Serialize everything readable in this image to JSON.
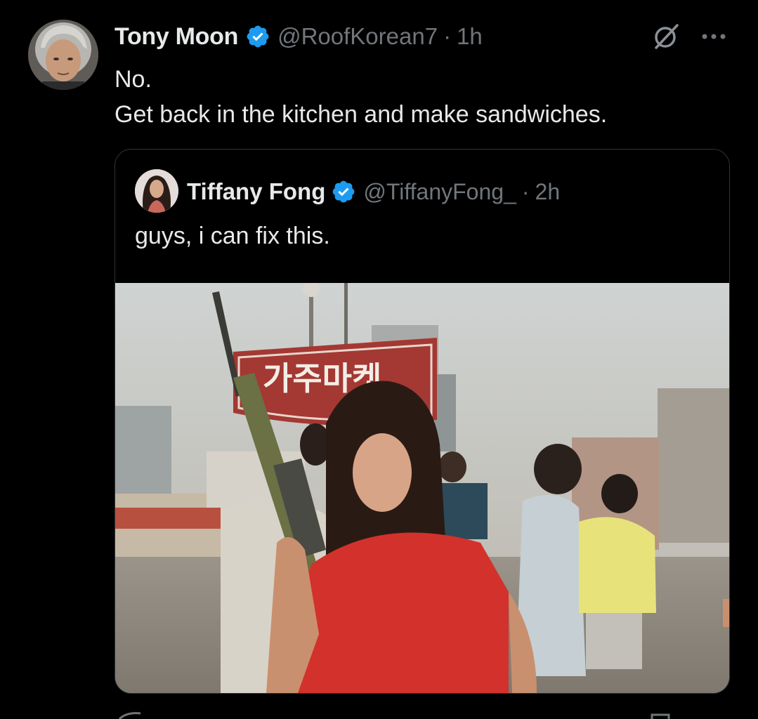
{
  "tweet": {
    "author_name": "Tony Moon",
    "handle": "@RoofKorean7",
    "separator": "·",
    "time": "1h",
    "body_lines": [
      "No.",
      "Get back in the kitchen and make sandwiches."
    ]
  },
  "quote": {
    "author_name": "Tiffany Fong",
    "handle": "@TiffanyFong_",
    "separator": "·",
    "time": "2h",
    "text": "guys, i can fix this.",
    "image_sign_text": "가주마켓"
  },
  "icons": {
    "verified": "verified-badge-icon",
    "grok": "grok-icon",
    "more": "more-icon"
  },
  "colors": {
    "background": "#000000",
    "primary_text": "#e7e9ea",
    "secondary_text": "#71767b",
    "verified_blue": "#1d9bf0",
    "border": "#2f3336"
  }
}
